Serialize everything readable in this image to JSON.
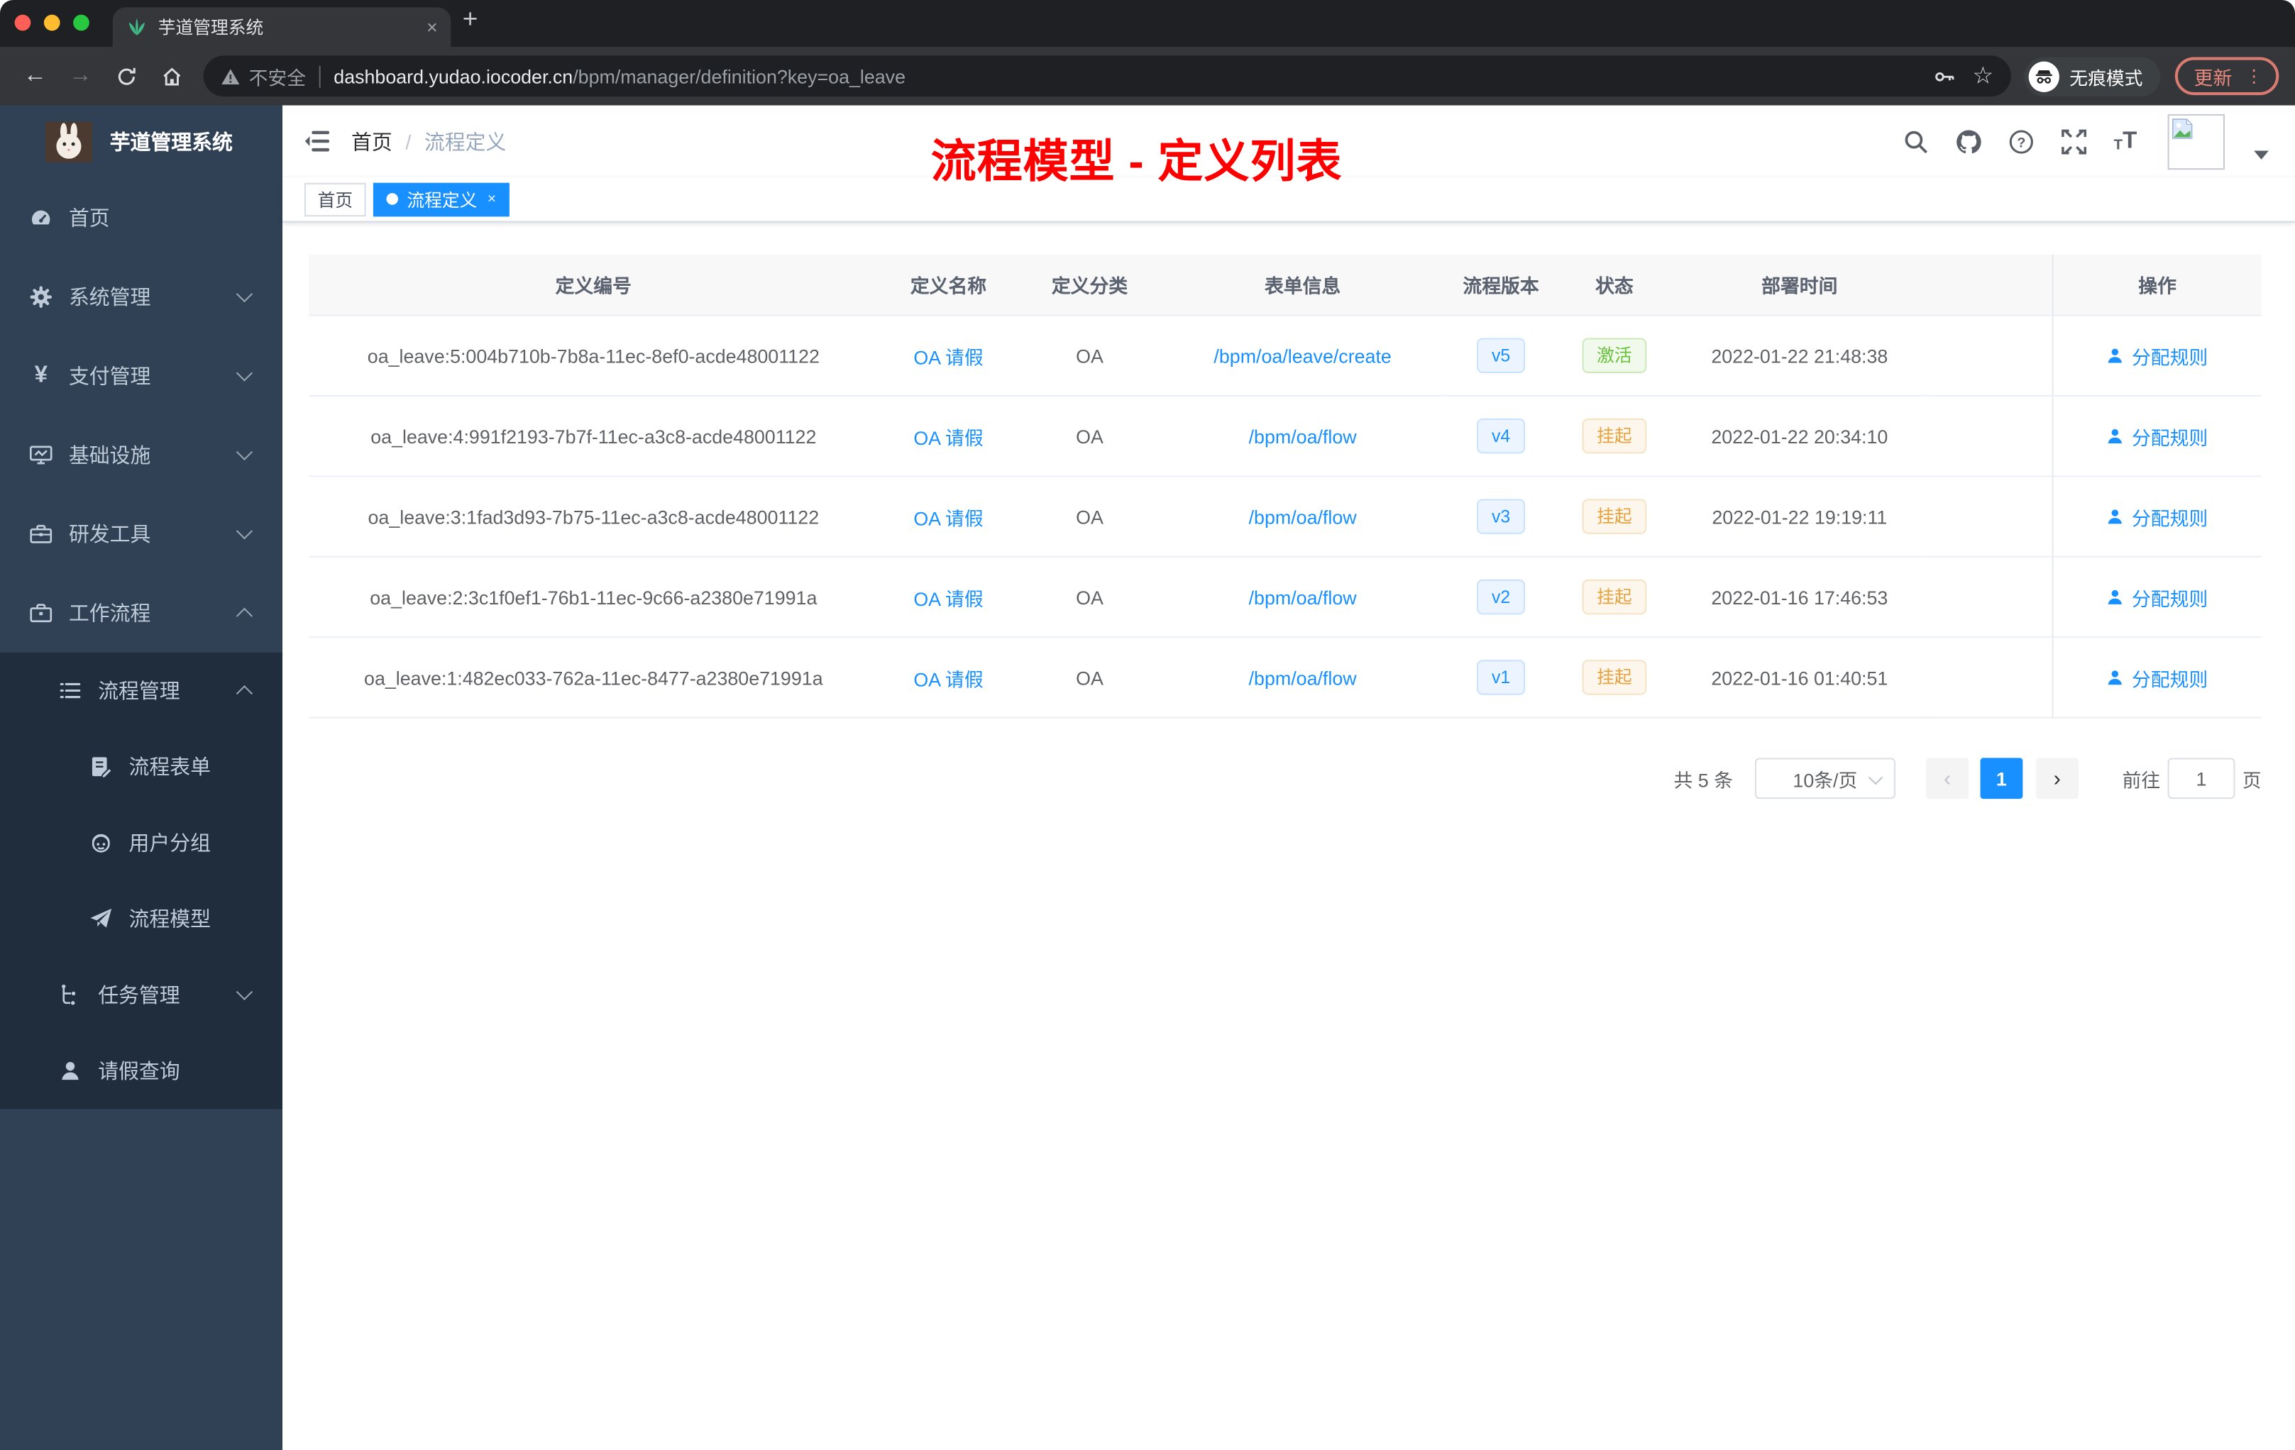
{
  "browser": {
    "tab_title": "芋道管理系统",
    "tab_close": "×",
    "new_tab": "+",
    "security_label": "不安全",
    "url_host": "dashboard.yudao.iocoder.cn",
    "url_path": "/bpm/manager/definition?key=oa_leave",
    "incognito_label": "无痕模式",
    "update_label": "更新",
    "menu_dots": "⋮",
    "back_glyph": "←",
    "forward_glyph": "→",
    "star_glyph": "☆"
  },
  "sidebar": {
    "app_title": "芋道管理系统",
    "items": [
      {
        "label": "首页",
        "icon": "dashboard-icon",
        "level": 1
      },
      {
        "label": "系统管理",
        "icon": "gear-icon",
        "level": 1,
        "expand": "down"
      },
      {
        "label": "支付管理",
        "icon": "yen-icon",
        "level": 1,
        "expand": "down"
      },
      {
        "label": "基础设施",
        "icon": "monitor-icon",
        "level": 1,
        "expand": "down"
      },
      {
        "label": "研发工具",
        "icon": "toolbox-icon",
        "level": 1,
        "expand": "down"
      },
      {
        "label": "工作流程",
        "icon": "briefcase-icon",
        "level": 1,
        "expand": "up"
      },
      {
        "label": "流程管理",
        "icon": "list-icon",
        "level": 2,
        "expand": "up"
      },
      {
        "label": "流程表单",
        "icon": "form-icon",
        "level": 3
      },
      {
        "label": "用户分组",
        "icon": "user-group-icon",
        "level": 3
      },
      {
        "label": "流程模型",
        "icon": "paper-plane-icon",
        "level": 3
      },
      {
        "label": "任务管理",
        "icon": "tree-icon",
        "level": 2,
        "expand": "down"
      },
      {
        "label": "请假查询",
        "icon": "person-icon",
        "level": 2
      }
    ],
    "yen_glyph": "¥"
  },
  "navbar": {
    "breadcrumb_home": "首页",
    "breadcrumb_separator": "/",
    "breadcrumb_current": "流程定义",
    "annotation": "流程模型 - 定义列表"
  },
  "tags_view": {
    "home_tag": "首页",
    "active_tag": "流程定义",
    "active_tag_close": "×"
  },
  "table": {
    "columns": {
      "id": "定义编号",
      "name": "定义名称",
      "category": "定义分类",
      "form": "表单信息",
      "version": "流程版本",
      "status": "状态",
      "deploy_time": "部署时间",
      "action": "操作"
    },
    "rows": [
      {
        "id": "oa_leave:5:004b710b-7b8a-11ec-8ef0-acde48001122",
        "name": "OA 请假",
        "category": "OA",
        "form": "/bpm/oa/leave/create",
        "version": "v5",
        "status": "激活",
        "deploy_time": "2022-01-22 21:48:38",
        "action": "分配规则"
      },
      {
        "id": "oa_leave:4:991f2193-7b7f-11ec-a3c8-acde48001122",
        "name": "OA 请假",
        "category": "OA",
        "form": "/bpm/oa/flow",
        "version": "v4",
        "status": "挂起",
        "deploy_time": "2022-01-22 20:34:10",
        "action": "分配规则"
      },
      {
        "id": "oa_leave:3:1fad3d93-7b75-11ec-a3c8-acde48001122",
        "name": "OA 请假",
        "category": "OA",
        "form": "/bpm/oa/flow",
        "version": "v3",
        "status": "挂起",
        "deploy_time": "2022-01-22 19:19:11",
        "action": "分配规则"
      },
      {
        "id": "oa_leave:2:3c1f0ef1-76b1-11ec-9c66-a2380e71991a",
        "name": "OA 请假",
        "category": "OA",
        "form": "/bpm/oa/flow",
        "version": "v2",
        "status": "挂起",
        "deploy_time": "2022-01-16 17:46:53",
        "action": "分配规则"
      },
      {
        "id": "oa_leave:1:482ec033-762a-11ec-8477-a2380e71991a",
        "name": "OA 请假",
        "category": "OA",
        "form": "/bpm/oa/flow",
        "version": "v1",
        "status": "挂起",
        "deploy_time": "2022-01-16 01:40:51",
        "action": "分配规则"
      }
    ]
  },
  "pagination": {
    "total": "共 5 条",
    "page_size": "10条/页",
    "prev_glyph": "‹",
    "current_page": "1",
    "next_glyph": "›",
    "goto_label": "前往",
    "goto_value": "1",
    "page_suffix": "页"
  },
  "colors": {
    "accent_blue": "#1890ff",
    "success_green": "#67c23a",
    "warning_orange": "#e6a23c",
    "annotation_red": "#ff0000",
    "sidebar_bg": "#304156",
    "submenu_bg": "#1f2d3d"
  }
}
